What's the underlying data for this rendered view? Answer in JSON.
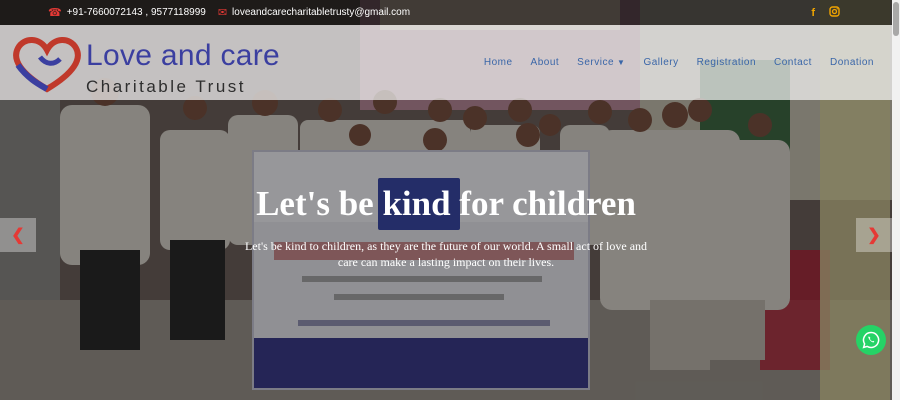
{
  "topbar": {
    "phone": "+91-7660072143 , 9577118999",
    "email": "loveandcarecharitabletrusty@gmail.com",
    "social": [
      "facebook-icon",
      "instagram-icon"
    ],
    "accent_color": "#e53935",
    "social_color": "#f0a400"
  },
  "logo": {
    "line1": "Love and care",
    "line2": "Charitable Trust"
  },
  "nav": {
    "items": [
      "Home",
      "About",
      "Service",
      "Gallery",
      "Registration",
      "Contact",
      "Donation"
    ],
    "color": "#3a66a8"
  },
  "hero": {
    "title": "Let's be kind for children",
    "subtitle": "Let's be kind to children, as they are the future of our world. A small act of love and care can make a lasting impact on their lives.",
    "prev_icon": "chevron-left-icon",
    "next_icon": "chevron-right-icon"
  },
  "banner": {
    "brand": "LOVE AND CARE CHARITABLE TRUST",
    "regno": "REGNO: 2/2024, APPROVAL UNDER SECTION 12A&80G,",
    "pan": "PAN NUMBER: AACTL5150G",
    "founder": "FOUNDER & CHAIRMAN : PALIVELA DAVID PAUL",
    "address1": "ADDRESS : 4-37, CHURCH STREET, KUNDURU B.O, KUNDURU,",
    "address2": "EAST GODAVARI, 533262, ANDHRA PRADESH, INDIA.",
    "contact": "CELL: +91 7660072143, EMAIL ID : pdpaulpalivela@gmail.com"
  },
  "whatsapp": {
    "icon": "whatsapp-icon",
    "color": "#25d366"
  }
}
